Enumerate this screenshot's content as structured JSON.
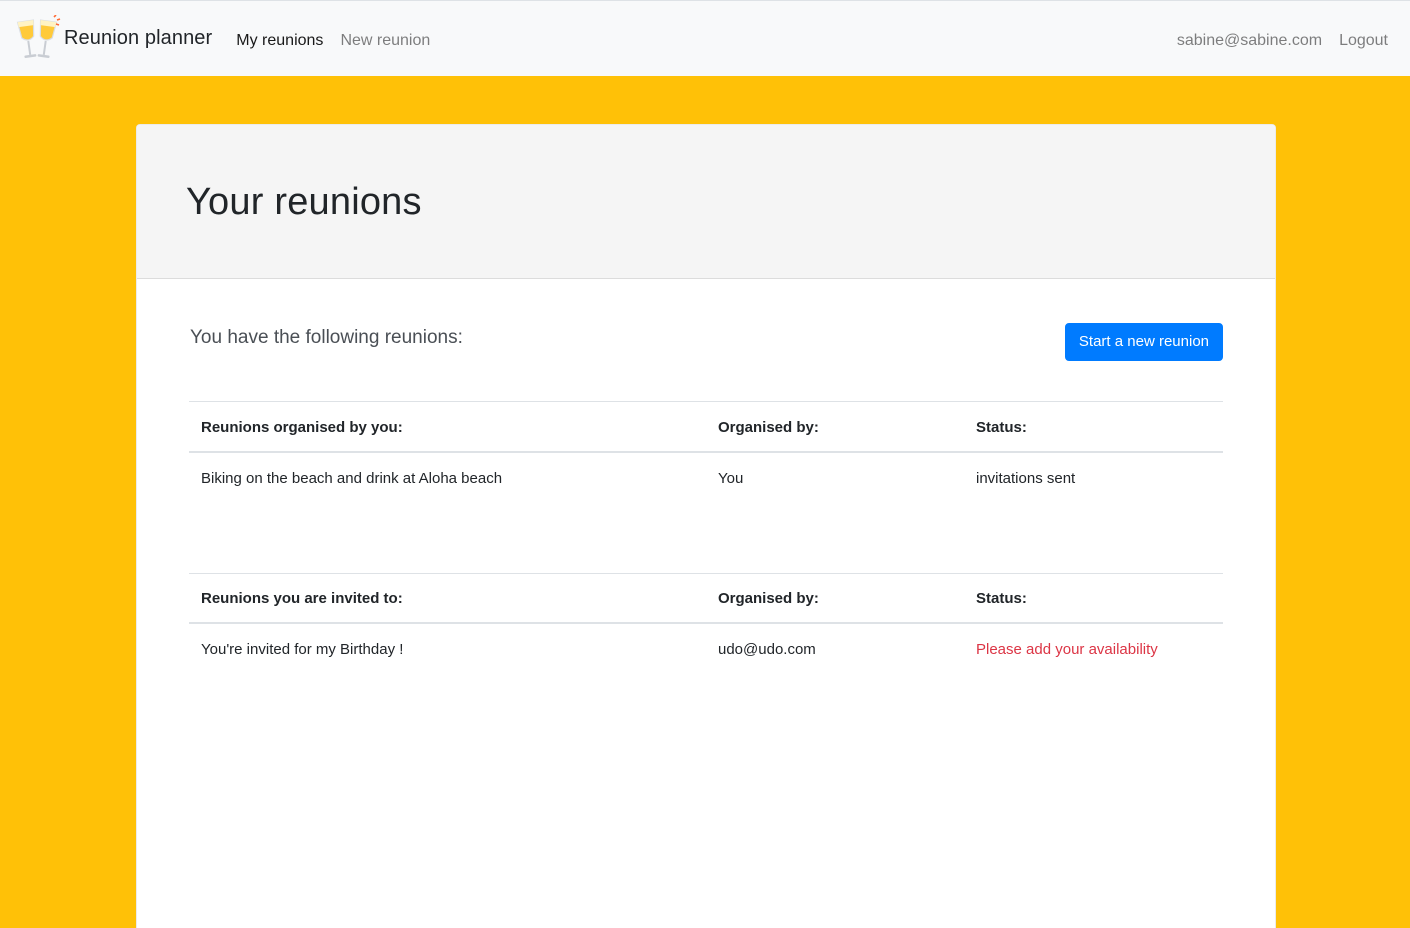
{
  "navbar": {
    "brand": "Reunion planner",
    "brand_icon": "champagne-glasses-icon",
    "links": [
      {
        "label": "My reunions",
        "active": true
      },
      {
        "label": "New reunion",
        "active": false
      }
    ],
    "user_email": "sabine@sabine.com",
    "logout_label": "Logout"
  },
  "page": {
    "title": "Your reunions",
    "lead": "You have the following reunions:",
    "new_button": "Start a new reunion"
  },
  "organised_table": {
    "headers": [
      "Reunions organised by you:",
      "Organised by:",
      "Status:"
    ],
    "rows": [
      {
        "name": "Biking on the beach and drink at Aloha beach",
        "organiser": "You",
        "status": "invitations sent"
      }
    ]
  },
  "invited_table": {
    "headers": [
      "Reunions you are invited to:",
      "Organised by:",
      "Status:"
    ],
    "rows": [
      {
        "name": "You're invited for my Birthday !",
        "organiser": "udo@udo.com",
        "status": "Please add your availability"
      }
    ]
  },
  "colors": {
    "background": "#ffc107",
    "primary": "#007bff",
    "warning_text": "#dc3545"
  }
}
